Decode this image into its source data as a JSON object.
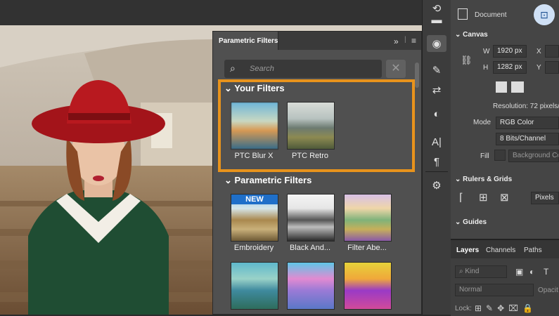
{
  "app": {
    "accent": "#e8931c",
    "panel_bg": "#505050",
    "dark_bg": "#323232"
  },
  "filters_panel": {
    "title": "Parametric Filters",
    "search_placeholder": "Search",
    "your_filters_heading": "Your Filters",
    "your_filters": [
      {
        "label": "PTC Blur X"
      },
      {
        "label": "PTC Retro"
      }
    ],
    "parametric_heading": "Parametric Filters",
    "new_badge": "NEW",
    "parametric_filters": [
      {
        "label": "Embroidery"
      },
      {
        "label": "Black And..."
      },
      {
        "label": "Filter Abe..."
      }
    ]
  },
  "properties": {
    "document_label": "Document",
    "canvas_heading": "Canvas",
    "w_label": "W",
    "w_value": "1920 px",
    "h_label": "H",
    "h_value": "1282 px",
    "x_label": "X",
    "y_label": "Y",
    "resolution": "Resolution: 72 pixels/in",
    "mode_label": "Mode",
    "mode_value": "RGB Color",
    "bits_value": "8 Bits/Channel",
    "fill_label": "Fill",
    "fill_value": "Background Co",
    "rulers_heading": "Rulers & Grids",
    "units_value": "Pixels",
    "guides_heading": "Guides"
  },
  "layers": {
    "tabs": [
      "Layers",
      "Channels",
      "Paths"
    ],
    "kind_placeholder": "Kind",
    "blend_mode": "Normal",
    "opacity_label": "Opacit",
    "lock_label": "Lock:"
  }
}
